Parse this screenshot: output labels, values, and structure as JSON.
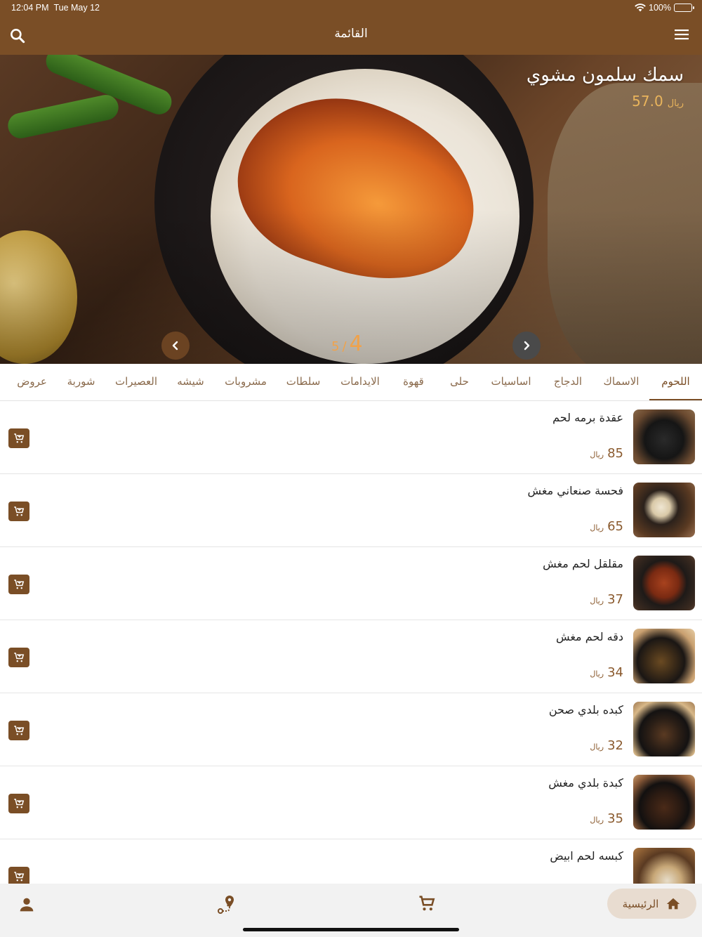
{
  "status_bar": {
    "time": "12:04 PM",
    "date": "Tue May 12",
    "battery": "100%"
  },
  "header": {
    "title": "القائمة",
    "search_icon": "search-icon",
    "menu_icon": "hamburger-menu-icon"
  },
  "hero": {
    "title": "سمك سلمون مشوي",
    "price": "57.0",
    "currency": "ريال",
    "current_slide": "4",
    "separator": "/",
    "total_slides": "5"
  },
  "tabs": [
    {
      "label": "اللحوم",
      "active": true
    },
    {
      "label": "الاسماك"
    },
    {
      "label": "الدجاج"
    },
    {
      "label": "اساسيات"
    },
    {
      "label": "حلى"
    },
    {
      "label": "قهوة"
    },
    {
      "label": "الايدامات"
    },
    {
      "label": "سلطات"
    },
    {
      "label": "مشروبات"
    },
    {
      "label": "شيشه"
    },
    {
      "label": "العصيرات"
    },
    {
      "label": "شوربة"
    },
    {
      "label": "عروض"
    }
  ],
  "items": [
    {
      "name": "عقدة برمه لحم",
      "price": "85",
      "currency": "ريال"
    },
    {
      "name": "فحسة صنعاني مغش",
      "price": "65",
      "currency": "ريال"
    },
    {
      "name": "مقلقل لحم مغش",
      "price": "37",
      "currency": "ريال"
    },
    {
      "name": "دقه لحم مغش",
      "price": "34",
      "currency": "ريال"
    },
    {
      "name": "كبده بلدي صحن",
      "price": "32",
      "currency": "ريال"
    },
    {
      "name": "كبدة بلدي مغش",
      "price": "35",
      "currency": "ريال"
    },
    {
      "name": "كبسه لحم ابيض",
      "price": "",
      "currency": ""
    }
  ],
  "bottom_nav": {
    "home_label": "الرئيسية"
  },
  "colors": {
    "brand": "#7a4e26",
    "price": "#8a5a2e",
    "hero_price": "#e9b45c",
    "counter": "#f0a24a"
  }
}
